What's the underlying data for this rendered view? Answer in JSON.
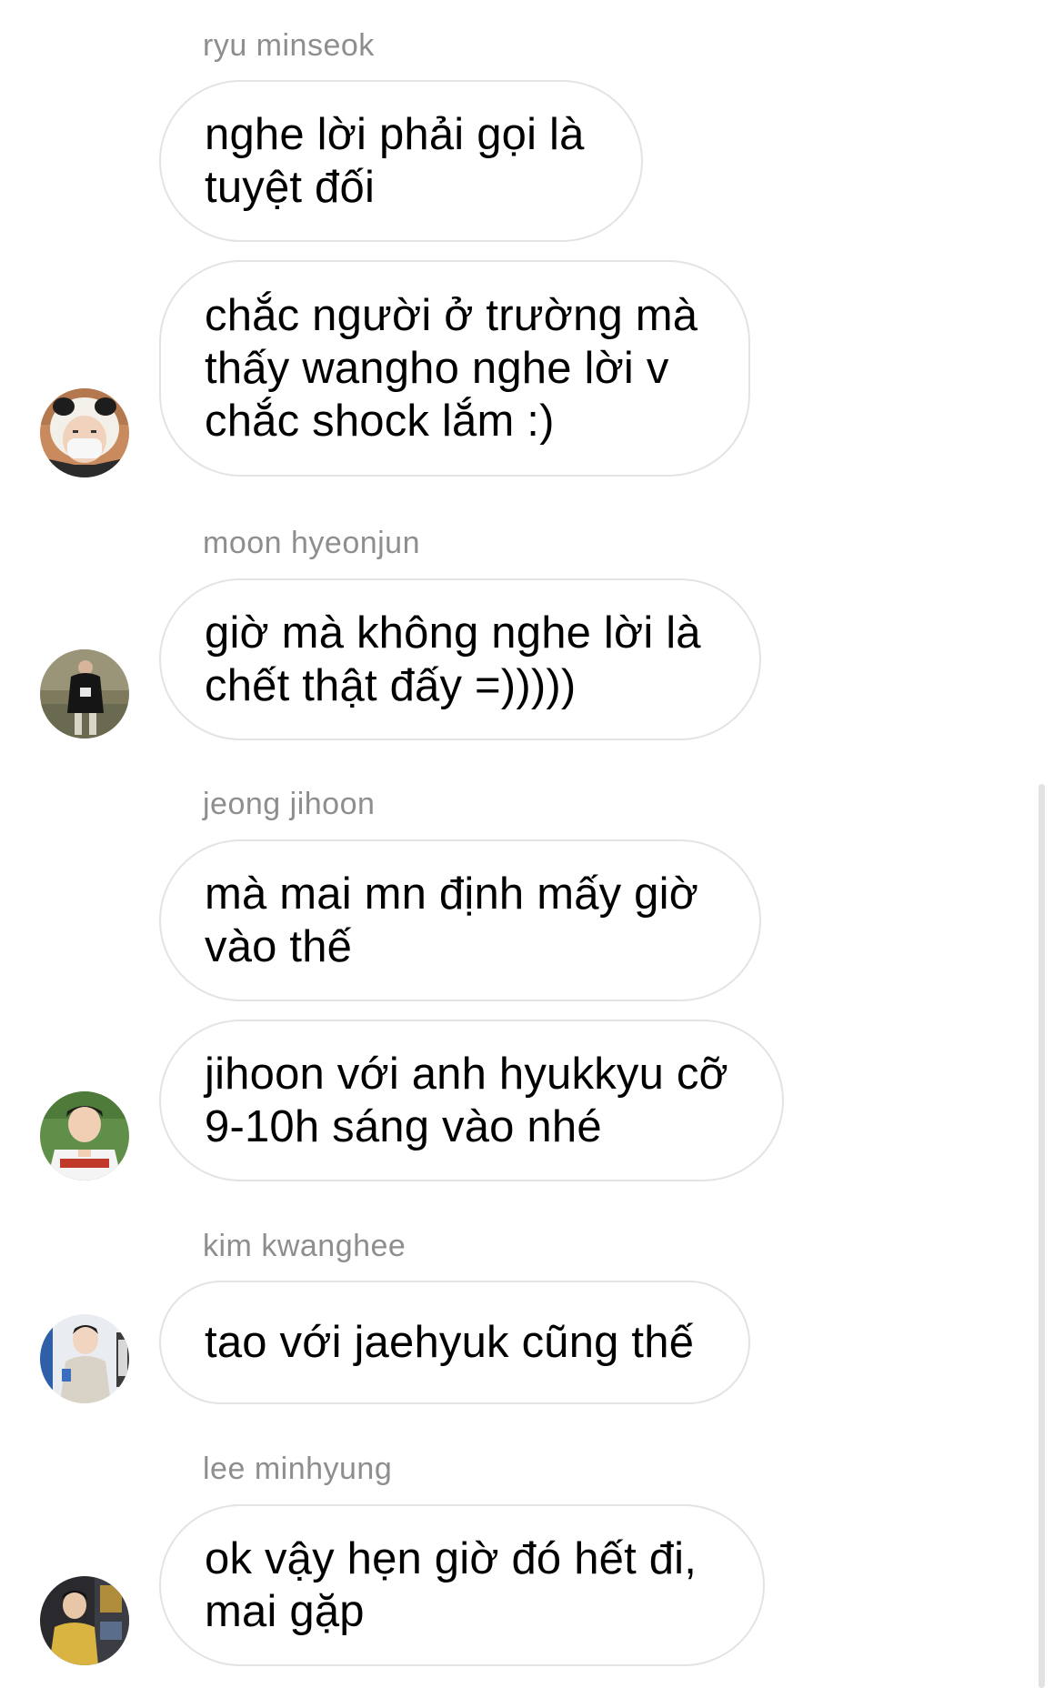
{
  "conversation": {
    "groups": [
      {
        "sender": "ryu minseok",
        "avatar_icon": "user-avatar-panda-hood-masked",
        "messages": [
          "nghe lời phải gọi là\ntuyệt đối",
          "chắc người ở trường mà\nthấy wangho nghe lời v\nchắc shock lắm :)"
        ]
      },
      {
        "sender": "moon hyeonjun",
        "avatar_icon": "user-avatar-black-hoodie",
        "messages": [
          "giờ mà không nghe lời là\nchết thật đấy =)))))"
        ]
      },
      {
        "sender": "jeong jihoon",
        "avatar_icon": "user-avatar-baseball-jersey",
        "messages": [
          "mà mai mn định mấy giờ\nvào thế",
          "jihoon với anh hyukkyu cỡ\n9-10h sáng vào nhé"
        ]
      },
      {
        "sender": "kim kwanghee",
        "avatar_icon": "user-avatar-beige-hoodie",
        "messages": [
          "tao với jaehyuk cũng thế"
        ]
      },
      {
        "sender": "lee minhyung",
        "avatar_icon": "user-avatar-yellow-jacket",
        "messages": [
          "ok vậy hẹn giờ đó hết đi,\nmai gặp"
        ]
      }
    ]
  },
  "colors": {
    "bubble_border": "#e3e3e3",
    "sender_text": "#8e8e8e",
    "message_text": "#000000",
    "background": "#ffffff"
  }
}
